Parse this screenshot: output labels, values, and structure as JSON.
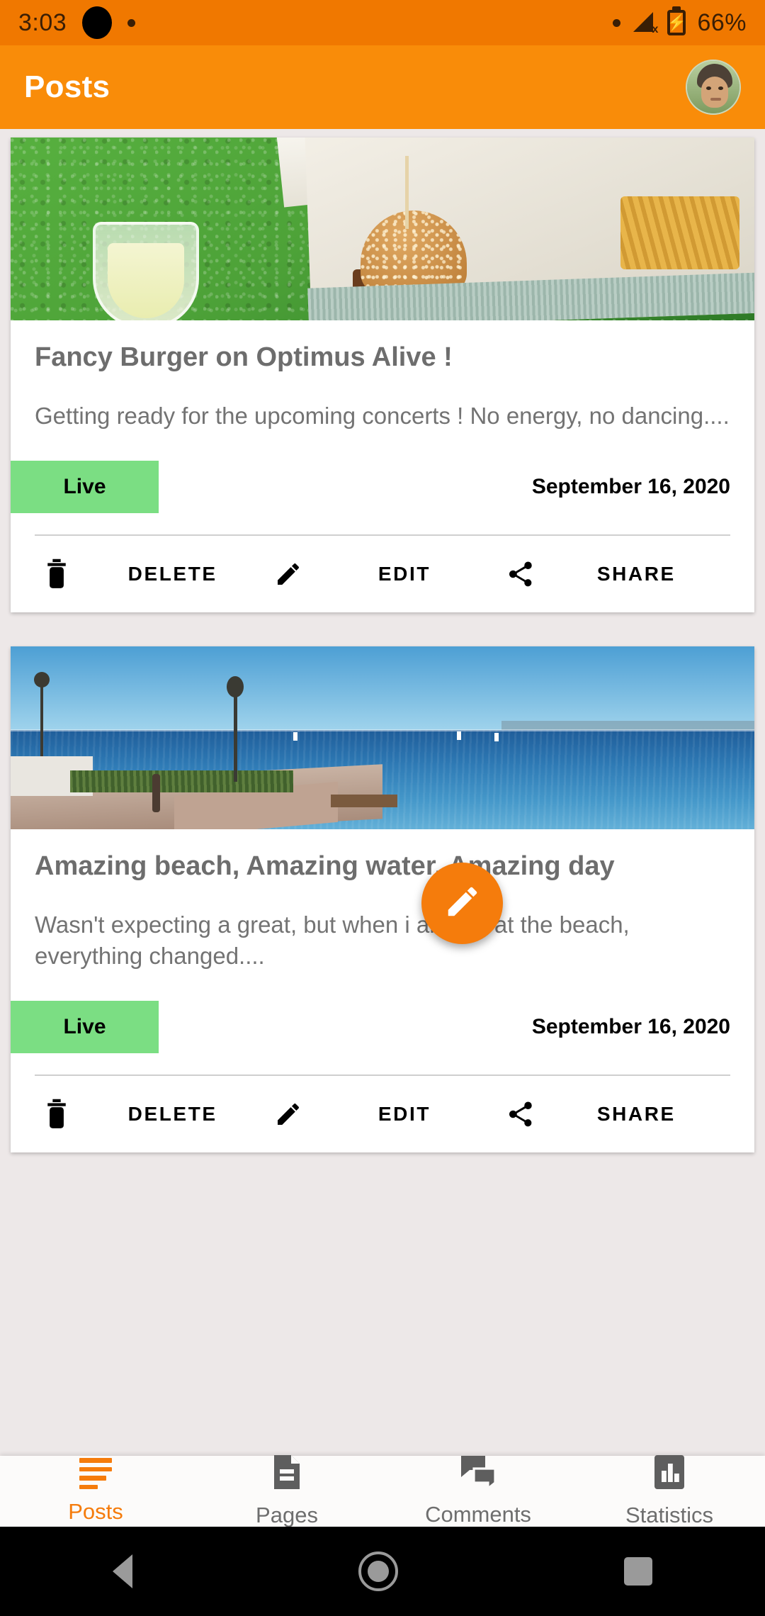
{
  "status_bar": {
    "time": "3:03",
    "battery_percent": "66%",
    "signal_icon": "signal-no-service-icon",
    "battery_icon": "battery-charging-icon",
    "camera_cutout": "camera-cutout"
  },
  "app_bar": {
    "title": "Posts",
    "avatar_label": "user-avatar",
    "background_color": "#F98C09"
  },
  "theme": {
    "accent": "#F57C0C",
    "status_bar_bg": "#F07800",
    "page_bg": "#EDE8E8",
    "live_badge_bg": "#7BDE83",
    "card_bg": "#FFFFFF"
  },
  "posts": [
    {
      "image_alt": "burger-in-box-on-grass-photo",
      "title": "Fancy Burger on Optimus Alive !",
      "excerpt": "Getting ready for the upcoming concerts ! No energy, no dancing....",
      "status": "Live",
      "date": "September 16, 2020",
      "actions": [
        {
          "icon": "trash-icon",
          "label": "DELETE"
        },
        {
          "icon": "pencil-icon",
          "label": "EDIT"
        },
        {
          "icon": "share-icon",
          "label": "SHARE"
        }
      ]
    },
    {
      "image_alt": "beach-sea-horizon-photo",
      "title": "Amazing beach, Amazing water, Amazing day",
      "excerpt": "Wasn't expecting a great, but when i arrived at the beach, everything changed....",
      "status": "Live",
      "date": "September 16, 2020",
      "actions": [
        {
          "icon": "trash-icon",
          "label": "DELETE"
        },
        {
          "icon": "pencil-icon",
          "label": "EDIT"
        },
        {
          "icon": "share-icon",
          "label": "SHARE"
        }
      ]
    }
  ],
  "fab": {
    "icon": "pencil-icon",
    "label": "Create new post"
  },
  "bottom_nav": {
    "items": [
      {
        "label": "Posts",
        "icon": "posts-lines-icon",
        "active": true
      },
      {
        "label": "Pages",
        "icon": "document-icon",
        "active": false
      },
      {
        "label": "Comments",
        "icon": "comments-icon",
        "active": false
      },
      {
        "label": "Statistics",
        "icon": "bar-chart-icon",
        "active": false
      }
    ]
  },
  "android_nav": {
    "back": "back-triangle-icon",
    "home": "home-circle-icon",
    "recents": "recents-square-icon"
  }
}
